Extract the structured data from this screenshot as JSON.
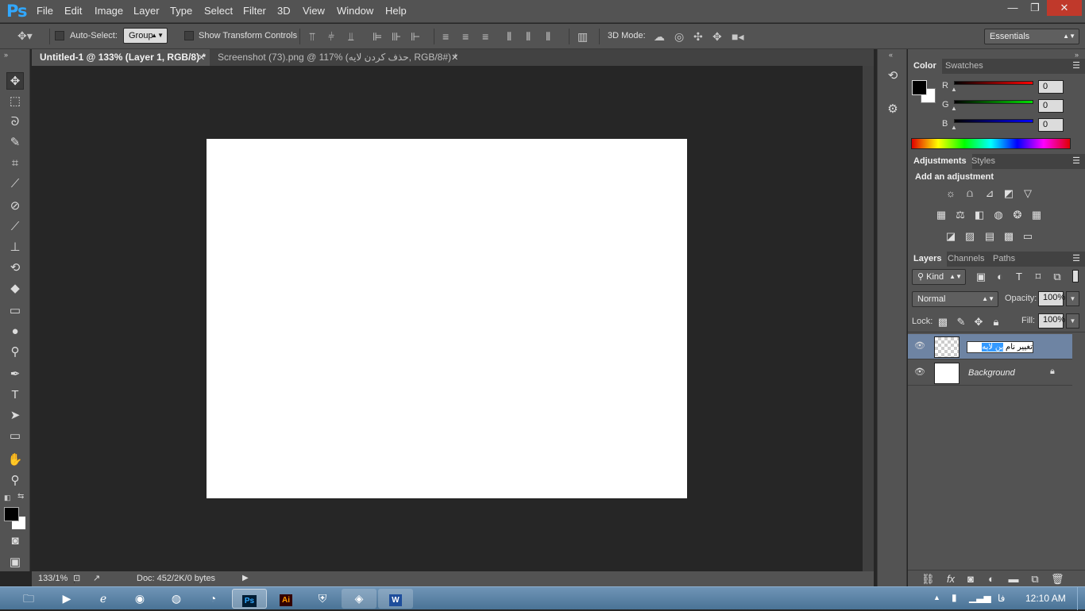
{
  "app": {
    "logo": "Ps"
  },
  "menu": [
    "File",
    "Edit",
    "Image",
    "Layer",
    "Type",
    "Select",
    "Filter",
    "3D",
    "View",
    "Window",
    "Help"
  ],
  "window_controls": {
    "minimize": "—",
    "restore": "❐",
    "close": "✕"
  },
  "options": {
    "auto_select_label": "Auto-Select:",
    "auto_select_value": "Group",
    "show_transform_label": "Show Transform Controls",
    "mode_label": "3D Mode:",
    "workspace": "Essentials"
  },
  "tabs": [
    {
      "label": "Untitled-1 @ 133% (Layer 1, RGB/8) *",
      "active": true
    },
    {
      "label": "Screenshot (73).png @ 117% (حذف کردن لایه, RGB/8#) *",
      "active": false
    }
  ],
  "status": {
    "zoom": "133/1%",
    "doc": "Doc: 452/2K/0 bytes"
  },
  "color_panel": {
    "tabs": [
      "Color",
      "Swatches"
    ],
    "channels": [
      {
        "label": "R",
        "value": "0",
        "color": "#e02020"
      },
      {
        "label": "G",
        "value": "0",
        "color": "#20c020"
      },
      {
        "label": "B",
        "value": "0",
        "color": "#2030e0"
      }
    ]
  },
  "adjustments_panel": {
    "tabs": [
      "Adjustments",
      "Styles"
    ],
    "heading": "Add an adjustment"
  },
  "layers_panel": {
    "tabs": [
      "Layers",
      "Channels",
      "Paths"
    ],
    "filter_kind": "Kind",
    "blend_mode": "Normal",
    "opacity_label": "Opacity:",
    "opacity_value": "100%",
    "lock_label": "Lock:",
    "fill_label": "Fill:",
    "fill_value": "100%",
    "layers": [
      {
        "name_edit_selected": "ین لایه",
        "name_edit_rest": "تغییر نام",
        "selected": true
      },
      {
        "name": "Background",
        "locked": true
      }
    ]
  },
  "taskbar": {
    "clock": "12:10 AM",
    "lang": "فا"
  }
}
